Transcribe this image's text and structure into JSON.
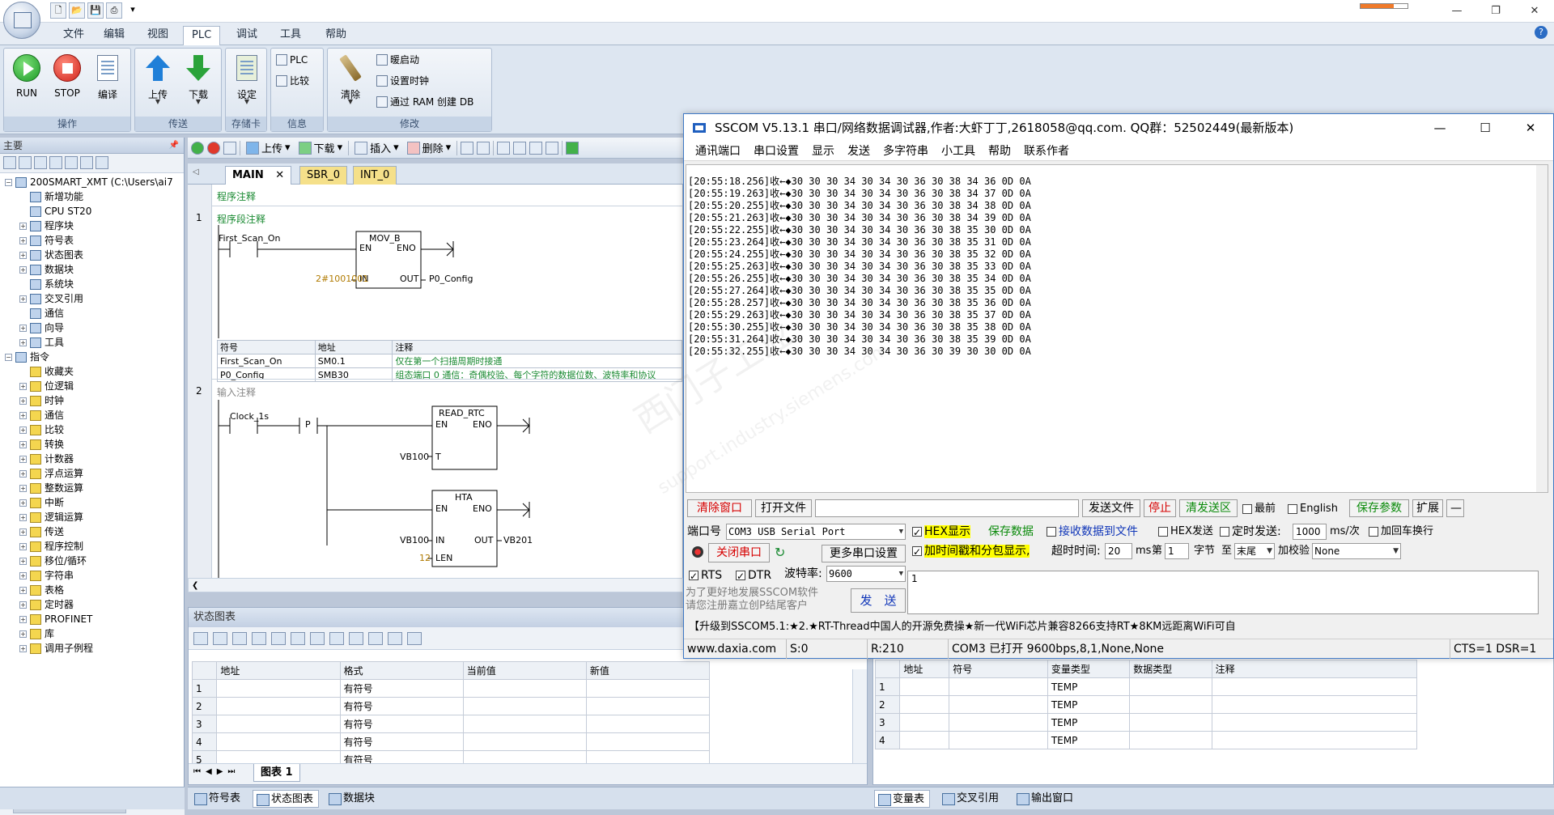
{
  "app": {
    "menu_tabs": [
      "文件",
      "编辑",
      "视图",
      "PLC",
      "调试",
      "工具",
      "帮助"
    ],
    "active_menu": "PLC"
  },
  "ribbon": {
    "run": "RUN",
    "stop": "STOP",
    "compile": "编译",
    "upload": "上传",
    "download": "下载",
    "setup": "设定",
    "plc": "PLC",
    "compare": "比较",
    "clear": "清除",
    "warm_start": "暖启动",
    "set_clock": "设置时钟",
    "create_db": "通过 RAM 创建 DB",
    "groups": [
      "操作",
      "传送",
      "存储卡",
      "信息",
      "修改"
    ]
  },
  "left_pane": {
    "title": "主要",
    "tree": [
      {
        "label": "200SMART_XMT (C:\\Users\\ai7",
        "level": 0,
        "pm": "−"
      },
      {
        "label": "新增功能",
        "level": 1,
        "pm": ""
      },
      {
        "label": "CPU ST20",
        "level": 1,
        "pm": ""
      },
      {
        "label": "程序块",
        "level": 1,
        "pm": "+"
      },
      {
        "label": "符号表",
        "level": 1,
        "pm": "+"
      },
      {
        "label": "状态图表",
        "level": 1,
        "pm": "+"
      },
      {
        "label": "数据块",
        "level": 1,
        "pm": "+"
      },
      {
        "label": "系统块",
        "level": 1,
        "pm": ""
      },
      {
        "label": "交叉引用",
        "level": 1,
        "pm": "+"
      },
      {
        "label": "通信",
        "level": 1,
        "pm": ""
      },
      {
        "label": "向导",
        "level": 1,
        "pm": "+"
      },
      {
        "label": "工具",
        "level": 1,
        "pm": "+"
      },
      {
        "label": "指令",
        "level": 0,
        "pm": "−"
      },
      {
        "label": "收藏夹",
        "level": 1,
        "pm": ""
      },
      {
        "label": "位逻辑",
        "level": 1,
        "pm": "+"
      },
      {
        "label": "时钟",
        "level": 1,
        "pm": "+"
      },
      {
        "label": "通信",
        "level": 1,
        "pm": "+"
      },
      {
        "label": "比较",
        "level": 1,
        "pm": "+"
      },
      {
        "label": "转换",
        "level": 1,
        "pm": "+"
      },
      {
        "label": "计数器",
        "level": 1,
        "pm": "+"
      },
      {
        "label": "浮点运算",
        "level": 1,
        "pm": "+"
      },
      {
        "label": "整数运算",
        "level": 1,
        "pm": "+"
      },
      {
        "label": "中断",
        "level": 1,
        "pm": "+"
      },
      {
        "label": "逻辑运算",
        "level": 1,
        "pm": "+"
      },
      {
        "label": "传送",
        "level": 1,
        "pm": "+"
      },
      {
        "label": "程序控制",
        "level": 1,
        "pm": "+"
      },
      {
        "label": "移位/循环",
        "level": 1,
        "pm": "+"
      },
      {
        "label": "字符串",
        "level": 1,
        "pm": "+"
      },
      {
        "label": "表格",
        "level": 1,
        "pm": "+"
      },
      {
        "label": "定时器",
        "level": 1,
        "pm": "+"
      },
      {
        "label": "PROFINET",
        "level": 1,
        "pm": "+"
      },
      {
        "label": "库",
        "level": 1,
        "pm": "+"
      },
      {
        "label": "调用子例程",
        "level": 1,
        "pm": "+"
      }
    ]
  },
  "editor_toolbar": {
    "upload": "上传",
    "download": "下载",
    "insert": "插入",
    "delete": "删除"
  },
  "prog_tabs": {
    "main": "MAIN",
    "sbr": "SBR_0",
    "int": "INT_0"
  },
  "ladder": {
    "program_comment": "程序注释",
    "net1_num": "1",
    "net1_comment": "程序段注释",
    "first_scan": "First_Scan_On",
    "mov_b": "MOV_B",
    "en": "EN",
    "eno": "ENO",
    "in": "IN",
    "out": "OUT",
    "in_val": "2#1001001",
    "out_val": "P0_Config",
    "sym_headers": [
      "符号",
      "地址",
      "注释"
    ],
    "sym_rows": [
      [
        "First_Scan_On",
        "SM0.1",
        "仅在第一个扫描周期时接通"
      ],
      [
        "P0_Config",
        "SMB30",
        "组态端口 0 通信：奇偶校验、每个字符的数据位数、波特率和协议"
      ]
    ],
    "net2_num": "2",
    "net2_comment": "输入注释",
    "clock": "Clock_1s",
    "p": "P",
    "read_rtc": "READ_RTC",
    "t": "T",
    "vb100": "VB100",
    "hta": "HTA",
    "len": "LEN",
    "len_val": "12",
    "vb201": "VB201"
  },
  "status_pane": {
    "title": "状态图表",
    "headers": [
      "地址",
      "格式",
      "当前值",
      "新值"
    ],
    "rows": [
      [
        "1",
        "",
        "有符号",
        "",
        ""
      ],
      [
        "2",
        "",
        "有符号",
        "",
        ""
      ],
      [
        "3",
        "",
        "有符号",
        "",
        ""
      ],
      [
        "4",
        "",
        "有符号",
        "",
        ""
      ],
      [
        "5",
        "",
        "有符号",
        "",
        ""
      ]
    ],
    "tab": "图表 1"
  },
  "var_pane": {
    "headers": [
      "地址",
      "符号",
      "变量类型",
      "数据类型",
      "注释"
    ],
    "rows": [
      [
        "1",
        "",
        "",
        "TEMP",
        "",
        ""
      ],
      [
        "2",
        "",
        "",
        "TEMP",
        "",
        ""
      ],
      [
        "3",
        "",
        "",
        "TEMP",
        "",
        ""
      ],
      [
        "4",
        "",
        "",
        "TEMP",
        "",
        ""
      ]
    ]
  },
  "bottom_tabs": {
    "symbols": "符号表",
    "status": "状态图表",
    "datablock": "数据块",
    "vars": "变量表",
    "xref": "交叉引用",
    "output": "输出窗口"
  },
  "sscom": {
    "title": "SSCOM V5.13.1 串口/网络数据调试器,作者:大虾丁丁,2618058@qq.com. QQ群：52502449(最新版本)",
    "menu": [
      "通讯端口",
      "串口设置",
      "显示",
      "发送",
      "多字符串",
      "小工具",
      "帮助",
      "联系作者"
    ],
    "recv_lines": [
      "[20:55:18.256]收←◆30 30 30 34 30 34 30 36 30 38 34 36 0D 0A",
      "[20:55:19.263]收←◆30 30 30 34 30 34 30 36 30 38 34 37 0D 0A",
      "[20:55:20.255]收←◆30 30 30 34 30 34 30 36 30 38 34 38 0D 0A",
      "[20:55:21.263]收←◆30 30 30 34 30 34 30 36 30 38 34 39 0D 0A",
      "[20:55:22.255]收←◆30 30 30 34 30 34 30 36 30 38 35 30 0D 0A",
      "[20:55:23.264]收←◆30 30 30 34 30 34 30 36 30 38 35 31 0D 0A",
      "[20:55:24.255]收←◆30 30 30 34 30 34 30 36 30 38 35 32 0D 0A",
      "[20:55:25.263]收←◆30 30 30 34 30 34 30 36 30 38 35 33 0D 0A",
      "[20:55:26.255]收←◆30 30 30 34 30 34 30 36 30 38 35 34 0D 0A",
      "[20:55:27.264]收←◆30 30 30 34 30 34 30 36 30 38 35 35 0D 0A",
      "[20:55:28.257]收←◆30 30 30 34 30 34 30 36 30 38 35 36 0D 0A",
      "[20:55:29.263]收←◆30 30 30 34 30 34 30 36 30 38 35 37 0D 0A",
      "[20:55:30.255]收←◆30 30 30 34 30 34 30 36 30 38 35 38 0D 0A",
      "[20:55:31.264]收←◆30 30 30 34 30 34 30 36 30 38 35 39 0D 0A",
      "[20:55:32.255]收←◆30 30 30 34 30 34 30 36 30 39 30 30 0D 0A"
    ],
    "watermark": "西门子工业",
    "watermark2": "support.industry.siemens.com",
    "clear_window": "清除窗口",
    "open_file": "打开文件",
    "send_file": "发送文件",
    "stop": "停止",
    "clear_send": "清发送区",
    "topmost": "最前",
    "english": "English",
    "save_params": "保存参数",
    "expand": "扩展",
    "collapse": "—",
    "port_label": "端口号",
    "port_value": "COM3 USB Serial Port",
    "hex_display": "HEX显示",
    "save_data": "保存数据",
    "recv_to_file": "接收数据到文件",
    "hex_send": "HEX发送",
    "timed_send": "定时发送:",
    "interval": "1000",
    "interval_unit": "ms/次",
    "add_crlf": "加回车换行",
    "close_port": "关闭串口",
    "more_settings": "更多串口设置",
    "timestamp": "加时间戳和分包显示,",
    "timeout_label": "超时时间:",
    "timeout_value": "20",
    "ms": "ms",
    "nth": "第",
    "byte_idx": "1",
    "byte_label": "字节",
    "to": "至",
    "end": "末尾",
    "checksum": "加校验",
    "checksum_value": "None",
    "rts": "RTS",
    "dtr": "DTR",
    "baud_label": "波特率:",
    "baud_value": "9600",
    "send_text": "1",
    "promo1": "为了更好地发展SSCOM软件",
    "promo2": "请您注册嘉立创P结尾客户",
    "send_btn": "发　送",
    "marquee": "【升级到SSCOM5.1:★2.★RT-Thread中国人的开源免费操★新一代WiFi芯片兼容8266支持RT★8KM远距离WiFi可自",
    "status_site": "www.daxia.com",
    "status_s": "S:0",
    "status_r": "R:210",
    "status_port": "COM3 已打开  9600bps,8,1,None,None",
    "status_cts": "CTS=1 DSR=1"
  },
  "colors": {
    "accent": "#3f79c5",
    "comment_green": "#1a8a32",
    "highlight": "#ffff00"
  }
}
